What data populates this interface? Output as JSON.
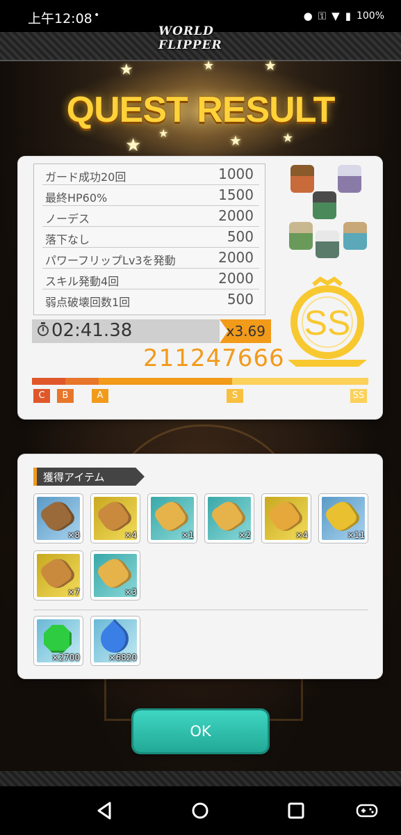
{
  "status_bar": {
    "time": "上午12:08",
    "dot": "•",
    "battery": "100%"
  },
  "header": {
    "logo": "WORLD FLIPPER"
  },
  "title": "QUEST RESULT",
  "bonuses": [
    {
      "label": "ガード成功20回",
      "value": "1000"
    },
    {
      "label": "最終HP60%",
      "value": "1500"
    },
    {
      "label": "ノーデス",
      "value": "2000"
    },
    {
      "label": "落下なし",
      "value": "500"
    },
    {
      "label": "パワーフリップLv3を発動",
      "value": "2000"
    },
    {
      "label": "スキル発動4回",
      "value": "2000"
    },
    {
      "label": "弱点破壊回数1回",
      "value": "500"
    }
  ],
  "clear_time": "02:41.38",
  "multiplier": "x3.69",
  "score": "211247666",
  "rank": "SS",
  "gauge_marks": [
    "C",
    "B",
    "A",
    "S",
    "SS"
  ],
  "items_section": {
    "title": "獲得アイテム",
    "items": [
      {
        "qty": "×8",
        "color": "#9a6a3a",
        "bg": "#7fb3d6"
      },
      {
        "qty": "×4",
        "color": "#c98a3e",
        "bg": "#e6c83a"
      },
      {
        "qty": "×1",
        "color": "#e6b24a",
        "bg": "#58c4c4"
      },
      {
        "qty": "×2",
        "color": "#e6b24a",
        "bg": "#58c4c4"
      },
      {
        "qty": "×4",
        "color": "#e6a83a",
        "bg": "#e6c83a"
      },
      {
        "qty": "×11",
        "color": "#e8c030",
        "bg": "#7fb3d6"
      },
      {
        "qty": "×7",
        "color": "#c98a3e",
        "bg": "#e6c83a"
      },
      {
        "qty": "×3",
        "color": "#e6b24a",
        "bg": "#58c4c4"
      }
    ],
    "currencies": [
      {
        "qty": "×2700",
        "color": "#2ecc40",
        "bg": "#9ad6e6",
        "icon": "green-gem-icon"
      },
      {
        "qty": "×6820",
        "color": "#3a7fe6",
        "bg": "#9ad6e6",
        "icon": "blue-flame-icon"
      }
    ]
  },
  "ok_button": "OK"
}
